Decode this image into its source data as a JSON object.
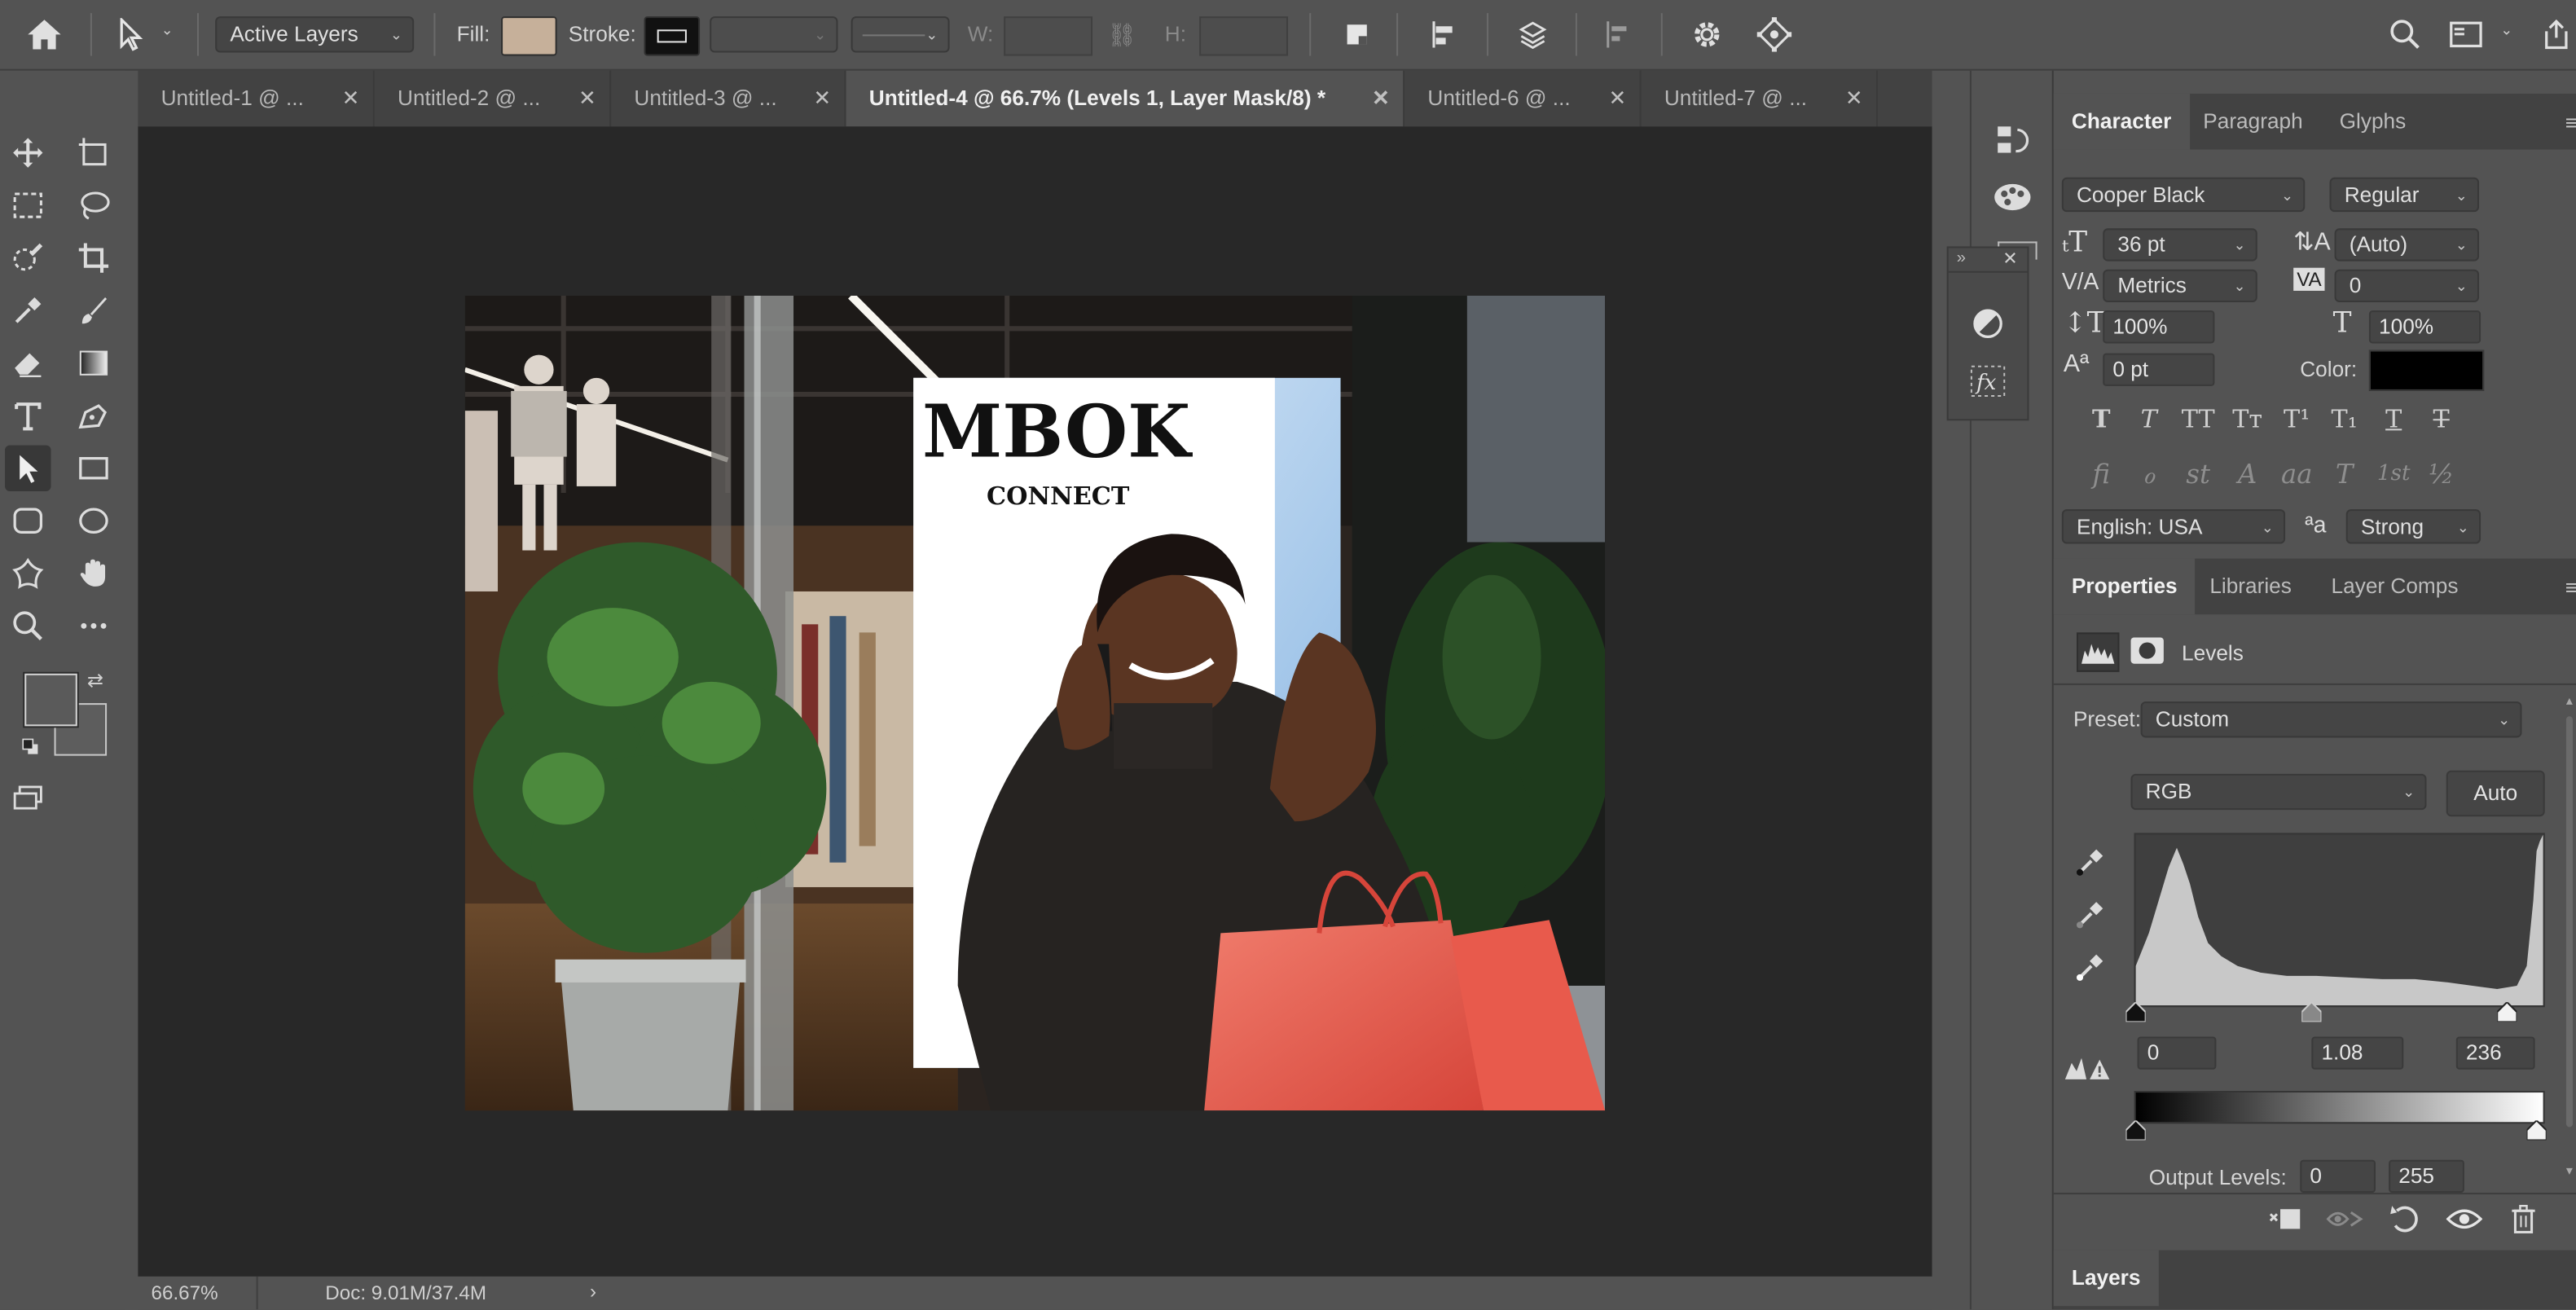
{
  "options_bar": {
    "layers_mode": "Active Layers",
    "fill_label": "Fill:",
    "fill_color": "#c6b09a",
    "stroke_label": "Stroke:",
    "w_label": "W:",
    "h_label": "H:"
  },
  "tabs": [
    {
      "label": "Untitled-1 @ ...",
      "active": false
    },
    {
      "label": "Untitled-2 @ ...",
      "active": false
    },
    {
      "label": "Untitled-3 @ ...",
      "active": false
    },
    {
      "label": "Untitled-4 @ 66.7% (Levels 1, Layer Mask/8) *",
      "active": true
    },
    {
      "label": "Untitled-6 @ ...",
      "active": false
    },
    {
      "label": "Untitled-7 @ ...",
      "active": false
    }
  ],
  "document": {
    "headline": "MBOK",
    "subline": "CONNECT"
  },
  "status": {
    "zoom": "66.67%",
    "doc_size": "Doc: 9.01M/37.4M"
  },
  "character": {
    "tabs": [
      "Character",
      "Paragraph",
      "Glyphs"
    ],
    "font_family": "Cooper Black",
    "font_style": "Regular",
    "font_size": "36 pt",
    "leading": "(Auto)",
    "kerning": "Metrics",
    "tracking": "0",
    "vertical_scale": "100%",
    "horizontal_scale": "100%",
    "baseline_shift": "0 pt",
    "color_label": "Color:",
    "text_color": "#000000",
    "type_buttons": [
      "T",
      "T",
      "TT",
      "Tт",
      "T¹",
      "T₁",
      "T",
      "T"
    ],
    "opentype_buttons": [
      "ﬁ",
      "ℴ",
      "st",
      "A",
      "aa",
      "T",
      "1st",
      "½"
    ],
    "language": "English: USA",
    "aa_glyph": "ªa",
    "antialias": "Strong"
  },
  "properties": {
    "tabs": [
      "Properties",
      "Libraries",
      "Layer Comps"
    ],
    "adjustment": "Levels",
    "preset_label": "Preset:",
    "preset_value": "Custom",
    "channel": "RGB",
    "auto_label": "Auto",
    "input_black": "0",
    "input_gamma": "1.08",
    "input_white": "236",
    "output_label": "Output Levels:",
    "output_black": "0",
    "output_white": "255"
  },
  "layers_panel": {
    "title": "Layers"
  }
}
